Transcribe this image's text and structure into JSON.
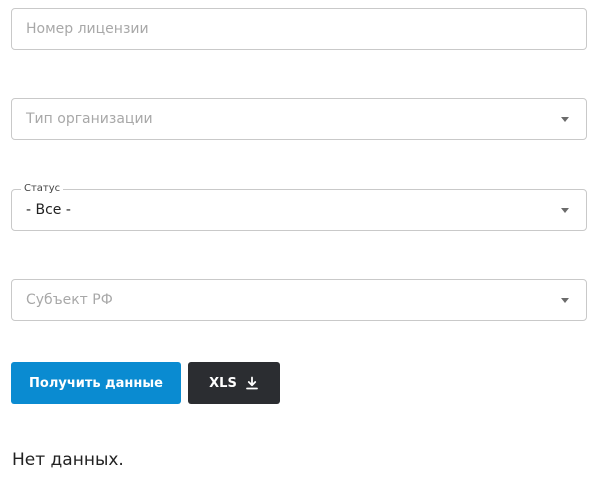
{
  "filters": {
    "license_number": {
      "placeholder": "Номер лицензии",
      "value": ""
    },
    "organization_type": {
      "placeholder": "Тип организации"
    },
    "status": {
      "label": "Статус",
      "selected": "- Все -"
    },
    "region": {
      "placeholder": "Субъект РФ"
    }
  },
  "actions": {
    "get_data_label": "Получить данные",
    "xls_label": "XLS"
  },
  "result": {
    "message": "Нет данных."
  },
  "colors": {
    "primary_button": "#0a8bd1",
    "dark_button": "#2b2d31",
    "border": "#c9c9c9",
    "placeholder": "#a8a8a8"
  },
  "icons": {
    "dropdown": "chevron-down-icon",
    "download": "download-icon"
  }
}
